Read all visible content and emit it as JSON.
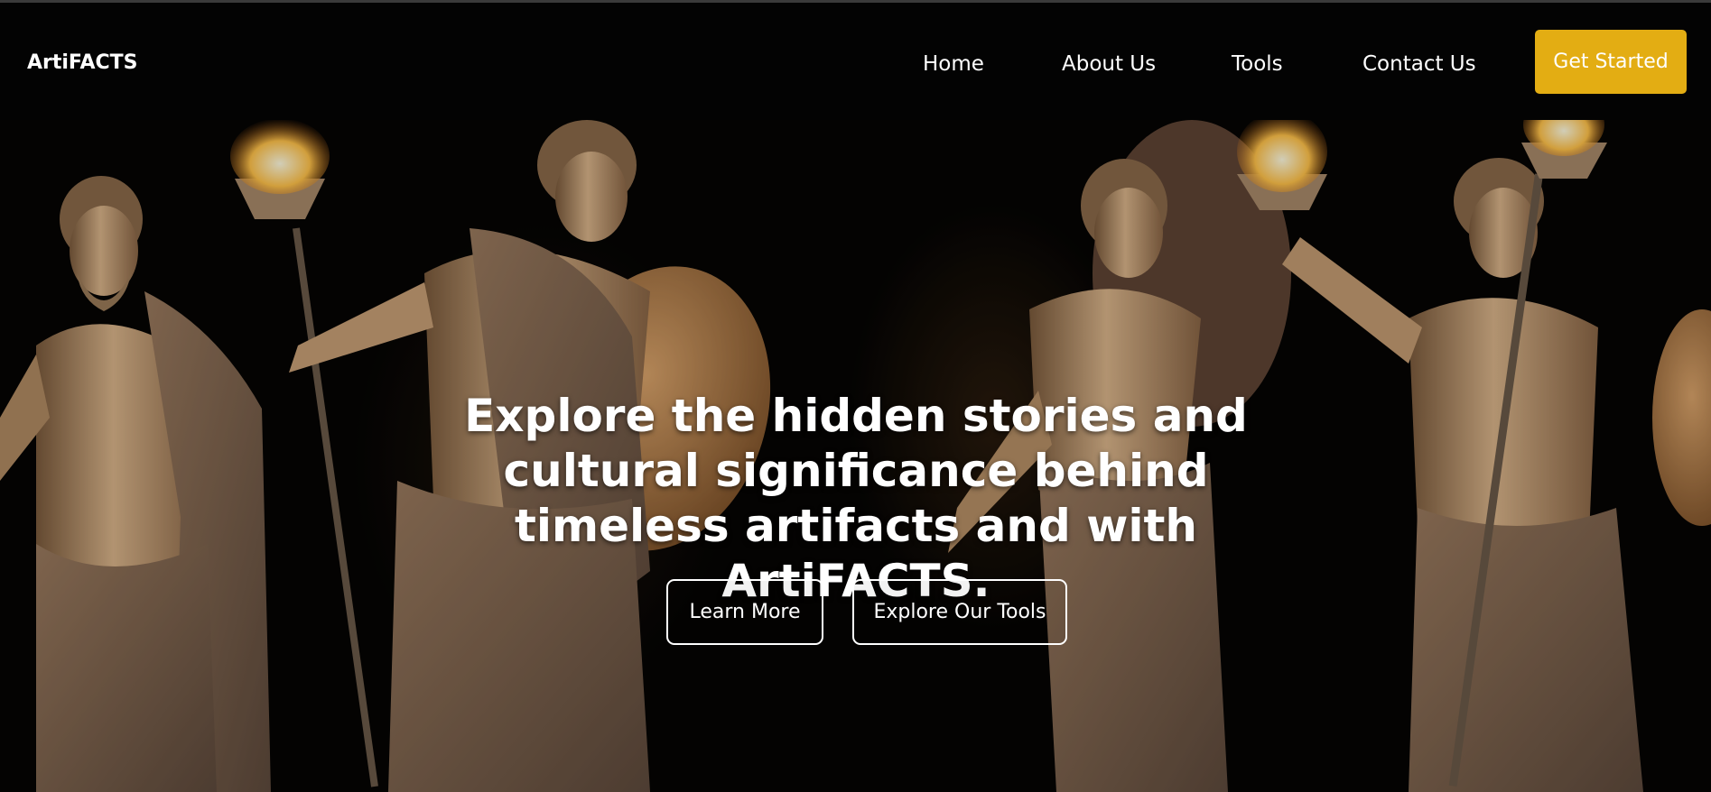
{
  "brand": {
    "name": "ArtiFACTS"
  },
  "nav": {
    "items": [
      {
        "label": "Home"
      },
      {
        "label": "About Us"
      },
      {
        "label": "Tools"
      },
      {
        "label": "Contact Us"
      }
    ],
    "cta_label": "Get Started"
  },
  "hero": {
    "headline": "Explore the hidden stories and cultural significance behind timeless artifacts and with ArtiFACTS.",
    "buttons": {
      "learn_more": "Learn More",
      "explore_tools": "Explore Our Tools"
    },
    "image_subject": "classical-statues-with-torches"
  },
  "colors": {
    "accent": "#e3ad13",
    "background": "#000000",
    "text": "#ffffff",
    "statue": "#c9a17a"
  }
}
